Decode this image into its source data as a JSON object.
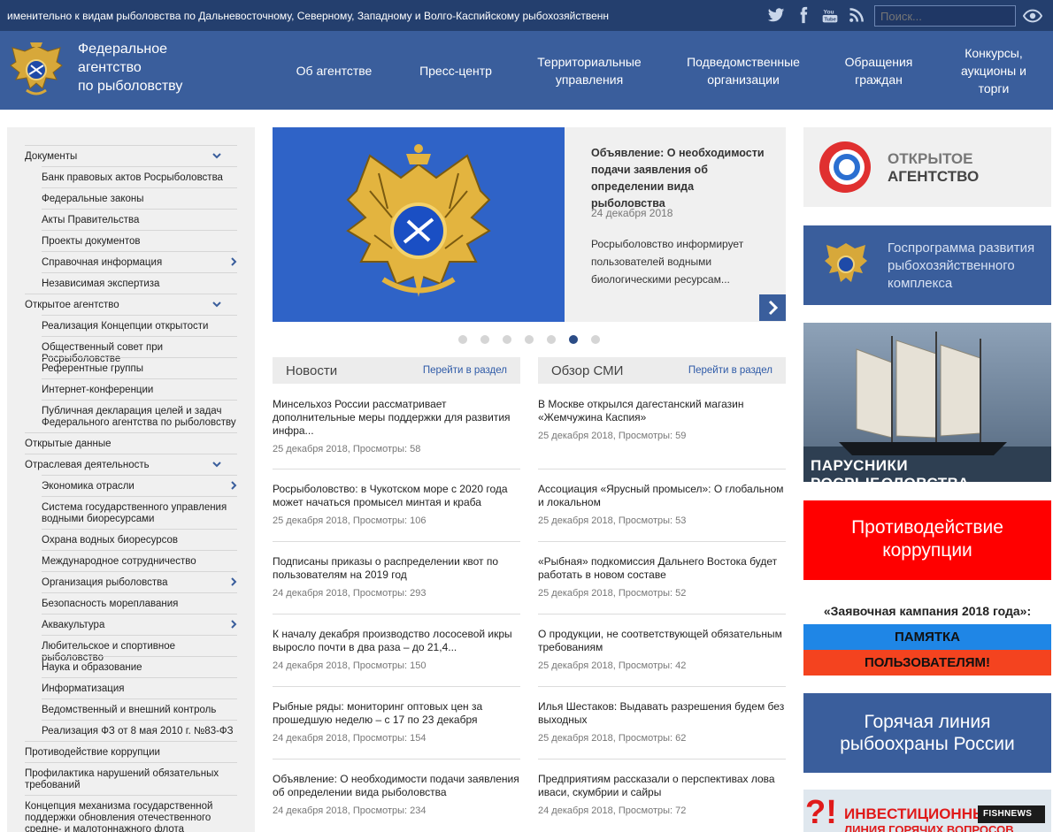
{
  "topbar": {
    "ticker": "именительно к видам рыболовства по Дальневосточному, Северному, Западному и Волго-Каспийскому рыбохозяйственн",
    "social": [
      "twitter-icon",
      "facebook-icon",
      "youtube-icon",
      "rss-icon"
    ],
    "search_placeholder": "Поиск...",
    "youtube_label": "You Tube"
  },
  "header": {
    "brand": [
      "Федеральное",
      "агентство",
      "по рыболовству"
    ],
    "nav": [
      "Об агентстве",
      "Пресс-центр",
      "Территориальные управления",
      "Подведомственные организации",
      "Обращения граждан",
      "Конкурсы, аукционы и торги"
    ]
  },
  "sidebar": {
    "items": [
      {
        "label": "Документы",
        "sub": false,
        "chev": "down"
      },
      {
        "label": "Банк правовых актов Росрыболовства",
        "sub": true
      },
      {
        "label": "Федеральные законы",
        "sub": true
      },
      {
        "label": "Акты Правительства",
        "sub": true
      },
      {
        "label": "Проекты документов",
        "sub": true
      },
      {
        "label": "Справочная информация",
        "sub": true,
        "chev": "right"
      },
      {
        "label": "Независимая экспертиза",
        "sub": true
      },
      {
        "label": "Открытое агентство",
        "sub": false,
        "chev": "down"
      },
      {
        "label": "Реализация Концепции открытости",
        "sub": true
      },
      {
        "label": "Общественный совет при Росрыболовстве",
        "sub": true
      },
      {
        "label": "Референтные группы",
        "sub": true
      },
      {
        "label": "Интернет-конференции",
        "sub": true
      },
      {
        "label": "Публичная декларация целей и задач Федерального агентства по рыболовству",
        "sub": true
      },
      {
        "label": "Открытые данные",
        "sub": false
      },
      {
        "label": "Отраслевая деятельность",
        "sub": false,
        "chev": "down"
      },
      {
        "label": "Экономика отрасли",
        "sub": true,
        "chev": "right"
      },
      {
        "label": "Система государственного управления водными биоресурсами",
        "sub": true
      },
      {
        "label": "Охрана водных биоресурсов",
        "sub": true
      },
      {
        "label": "Международное сотрудничество",
        "sub": true
      },
      {
        "label": "Организация рыболовства",
        "sub": true,
        "chev": "right"
      },
      {
        "label": "Безопасность мореплавания",
        "sub": true
      },
      {
        "label": "Аквакультура",
        "sub": true,
        "chev": "right"
      },
      {
        "label": "Любительское и спортивное рыболовство",
        "sub": true
      },
      {
        "label": "Наука и образование",
        "sub": true
      },
      {
        "label": "Информатизация",
        "sub": true
      },
      {
        "label": "Ведомственный и внешний контроль",
        "sub": true
      },
      {
        "label": "Реализация ФЗ от 8 мая 2010 г. №83-ФЗ",
        "sub": true
      },
      {
        "label": "Противодействие коррупции",
        "sub": false
      },
      {
        "label": "Профилактика нарушений обязательных требований",
        "sub": false
      },
      {
        "label": "Концепция механизма государственной поддержки обновления отечественного средне- и малотоннажного флота",
        "sub": false
      }
    ]
  },
  "slider": {
    "title": "Объявление: О необходимости подачи заявления об определении вида рыболовства",
    "date": "24 декабря 2018",
    "text": "Росрыболовство информирует пользователей водными биологическими ресурсам...",
    "dots": 7,
    "active_dot": 6
  },
  "news": {
    "title": "Новости",
    "link": "Перейти в раздел",
    "items": [
      {
        "title": "Минсельхоз России рассматривает дополнительные меры поддержки для развития инфра...",
        "meta": "25 декабря 2018, Просмотры: 58"
      },
      {
        "title": "Росрыболовство: в Чукотском море с 2020 года может начаться промысел минтая и краба",
        "meta": "25 декабря 2018, Просмотры: 106"
      },
      {
        "title": "Подписаны приказы о распределении квот по пользователям на 2019 год",
        "meta": "24 декабря 2018, Просмотры: 293"
      },
      {
        "title": "К началу декабря производство лососевой икры выросло почти в два раза – до 21,4...",
        "meta": "24 декабря 2018, Просмотры: 150"
      },
      {
        "title": "Рыбные ряды: мониторинг оптовых цен за прошедшую неделю – с 17 по 23 декабря",
        "meta": "24 декабря 2018, Просмотры: 154"
      },
      {
        "title": "Объявление: О необходимости подачи заявления об определении вида рыболовства",
        "meta": "24 декабря 2018, Просмотры: 234"
      }
    ]
  },
  "media": {
    "title": "Обзор СМИ",
    "link": "Перейти в раздел",
    "items": [
      {
        "title": "В Москве открылся дагестанский магазин «Жемчужина Каспия»",
        "meta": "25 декабря 2018, Просмотры: 59"
      },
      {
        "title": "Ассоциация «Ярусный промысел»: О глобальном и локальном",
        "meta": "25 декабря 2018, Просмотры: 53"
      },
      {
        "title": "«Рыбная» подкомиссия Дальнего Востока будет работать в новом составе",
        "meta": "25 декабря 2018, Просмотры: 52"
      },
      {
        "title": "О продукции, не соответствующей обязательным требованиям",
        "meta": "25 декабря 2018, Просмотры: 42"
      },
      {
        "title": "Илья Шестаков: Выдавать разрешения будем без выходных",
        "meta": "25 декабря 2018, Просмотры: 62"
      },
      {
        "title": "Предприятиям рассказали о перспективах лова иваси, скумбрии и сайры",
        "meta": "24 декабря 2018, Просмотры: 72"
      }
    ]
  },
  "banners": {
    "open_agency": [
      "ОТКРЫТОЕ",
      "АГЕНТСТВО"
    ],
    "gosprogram": "Госпрограмма развития рыбохозяйственного комплекса",
    "sailboats": "ПАРУСНИКИ РОСРЫБОЛОВСТВА",
    "anticorruption": "Противодействие коррупции",
    "campaign": "«Заявочная кампания 2018 года»:",
    "memo": "ПАМЯТКА",
    "users": "ПОЛЬЗОВАТЕЛЯМ!",
    "hotline": "Горячая линия рыбоохраны России",
    "investment_q": "?!",
    "investment": "ИНВЕСТИЦИОННЫЕ",
    "investment_2": "ЛИНИЯ ГОРЯЧИХ ВОПРОСОВ",
    "fishnews_a": "FISH",
    "fishnews_b": "NEWS"
  },
  "colors": {
    "topbar": "#243f6e",
    "header": "#3a5e9c",
    "anticorruption": "#ff0000",
    "hotline": "#3a5e9c",
    "flag_blue": "#2f63c7"
  }
}
